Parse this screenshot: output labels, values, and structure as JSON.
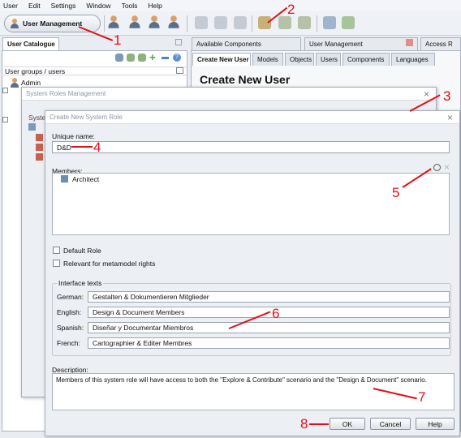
{
  "menu": [
    "User",
    "Edit",
    "Settings",
    "Window",
    "Tools",
    "Help"
  ],
  "toolbar": {
    "user_mgmt_label": "User Management"
  },
  "left_panel": {
    "tab_label": "User Catalogue",
    "section_label": "User groups / users",
    "items": [
      "Admin"
    ],
    "obscured_label": "System"
  },
  "right_panel": {
    "top_tabs": [
      "Available Components",
      "User Management",
      "Access R"
    ],
    "sub_tabs": [
      "Create New User",
      "Models",
      "Objects",
      "Users",
      "Components",
      "Languages"
    ],
    "heading": "Create New User"
  },
  "srm_dialog": {
    "title": "System Roles Management"
  },
  "dialog": {
    "title": "Create New System Role",
    "unique_name_label": "Unique name:",
    "unique_name_value": "D&D",
    "members_label": "Members:",
    "members": [
      "Architect"
    ],
    "default_role_label": "Default Role",
    "metamodel_label": "Relevant for metamodel rights",
    "interface_group_label": "Interface texts",
    "interface_texts": [
      {
        "lang": "German:",
        "value": "Gestalten & Dokumentieren Mitglieder"
      },
      {
        "lang": "English:",
        "value": "Design & Document Members"
      },
      {
        "lang": "Spanish:",
        "value": "Diseñar y Documentar Miembros"
      },
      {
        "lang": "French:",
        "value": "Cartographier & Editer Membres"
      }
    ],
    "description_label": "Description:",
    "description_value": "Members of this system role will have access to both the \"Explore & Contribute\" scenario and the \"Design & Document\" scenario.",
    "ok_label": "OK",
    "cancel_label": "Cancel",
    "help_label": "Help"
  },
  "annotations": [
    "1",
    "2",
    "3",
    "4",
    "5",
    "6",
    "7",
    "8"
  ],
  "colors": {
    "annotation": "#e0101a",
    "selected_tab": "#ffffff",
    "dialog_bg": "#eceff3"
  }
}
